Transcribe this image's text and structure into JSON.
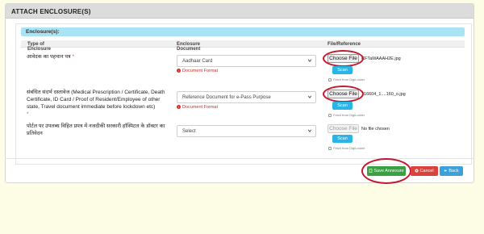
{
  "header": {
    "title": "ATTACH ENCLOSURE(S)"
  },
  "enclosures": {
    "bar_label": "Enclosure(s):",
    "columns": [
      "Type of Enclosure",
      "Enclosure Document",
      "File/Reference"
    ],
    "required_mark": "*",
    "rows": [
      {
        "label": "आवेदक का पहचान पत्र",
        "required": "*",
        "select_value": "Aadhaar Card",
        "doc_format": "Document Format",
        "choose_label": "Choose File",
        "file_name": "CFTaWAAAH2E.jpg",
        "scan_label": "Scan",
        "fetch_label": "Fetch from DigiLocker"
      },
      {
        "label": "संबंधित संदर्भ दस्तावेज (Medical Prescription / Certificate, Death Certificate, ID Card / Proof of Resident/Employee of other state, Travel document immediate before lockdown etc)",
        "required": "*",
        "select_value": "Reference Document for e-Pass Purpose",
        "doc_format": "Document Format",
        "choose_label": "Choose File",
        "file_name": "716604_1....160_o.jpg",
        "scan_label": "Scan",
        "fetch_label": "Fetch from DigiLocker"
      },
      {
        "label": "पोर्टल पर उपलब्ध विहित प्रपत्र में नजदीकी सरकारी हॉस्पिटल के डॉक्टर का प्रतिवेदन",
        "required": "",
        "select_value": "Select",
        "choose_label": "Choose File",
        "file_name": "No file chosen",
        "scan_label": "Scan",
        "fetch_label": "Fetch from DigiLocker"
      }
    ]
  },
  "actions": {
    "save_label": "Save Annexure",
    "cancel_label": "Cancel",
    "back_label": "Back"
  },
  "colors": {
    "save": "#3aa140",
    "cancel": "#d9433c",
    "back": "#3ca0db",
    "scan": "#29b6e6",
    "highlight_ring": "#c4182d"
  },
  "icons": [
    "chevron-down-icon",
    "info-icon",
    "digilocker-icon",
    "document-icon",
    "close-icon",
    "back-arrow-icon"
  ]
}
